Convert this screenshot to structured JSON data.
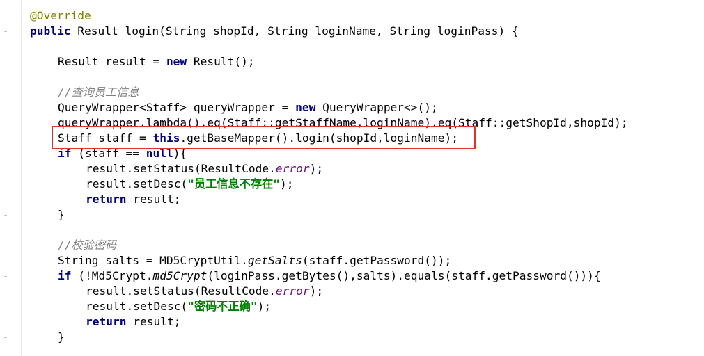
{
  "code": {
    "l1": [
      "@Override"
    ],
    "l2": [
      "public",
      " Result login(String shopId, String loginName, String loginPass) {"
    ],
    "l4": [
      "Result result = ",
      "new",
      " Result();"
    ],
    "l6": [
      "//查询员工信息"
    ],
    "l7": [
      "QueryWrapper<Staff> queryWrapper = ",
      "new",
      " QueryWrapper<>();"
    ],
    "l8": [
      "queryWrapper.lambda().eq(Staff::getStaffName,loginName).eq(Staff::getShopId,shopId);"
    ],
    "l9": [
      "Staff staff = ",
      "this",
      ".getBaseMapper().login(shopId,loginName);"
    ],
    "l10": [
      "if",
      " (staff == ",
      "null",
      "){"
    ],
    "l11": [
      "result.setStatus(ResultCode.",
      "error",
      ");"
    ],
    "l12": [
      "result.setDesc(",
      "\"员工信息不存在\"",
      ");"
    ],
    "l13": [
      "return",
      " result;"
    ],
    "l14": [
      "}"
    ],
    "l16": [
      "//校验密码"
    ],
    "l17": [
      "String salts = MD5CryptUtil.",
      "getSalts",
      "(staff.getPassword());"
    ],
    "l18": [
      "if",
      " (!Md5Crypt.",
      "md5Crypt",
      "(loginPass.getBytes(),salts).equals(staff.getPassword())){"
    ],
    "l19": [
      "result.setStatus(ResultCode.",
      "error",
      ");"
    ],
    "l20": [
      "result.setDesc(",
      "\"密码不正确\"",
      ");"
    ],
    "l21": [
      "return",
      " result;"
    ],
    "l22": [
      "}"
    ]
  },
  "colors": {
    "keyword": "#000080",
    "annotation": "#808000",
    "comment": "#808080",
    "string": "#008000",
    "field": "#660e7a",
    "highlight": "#dd3333"
  }
}
